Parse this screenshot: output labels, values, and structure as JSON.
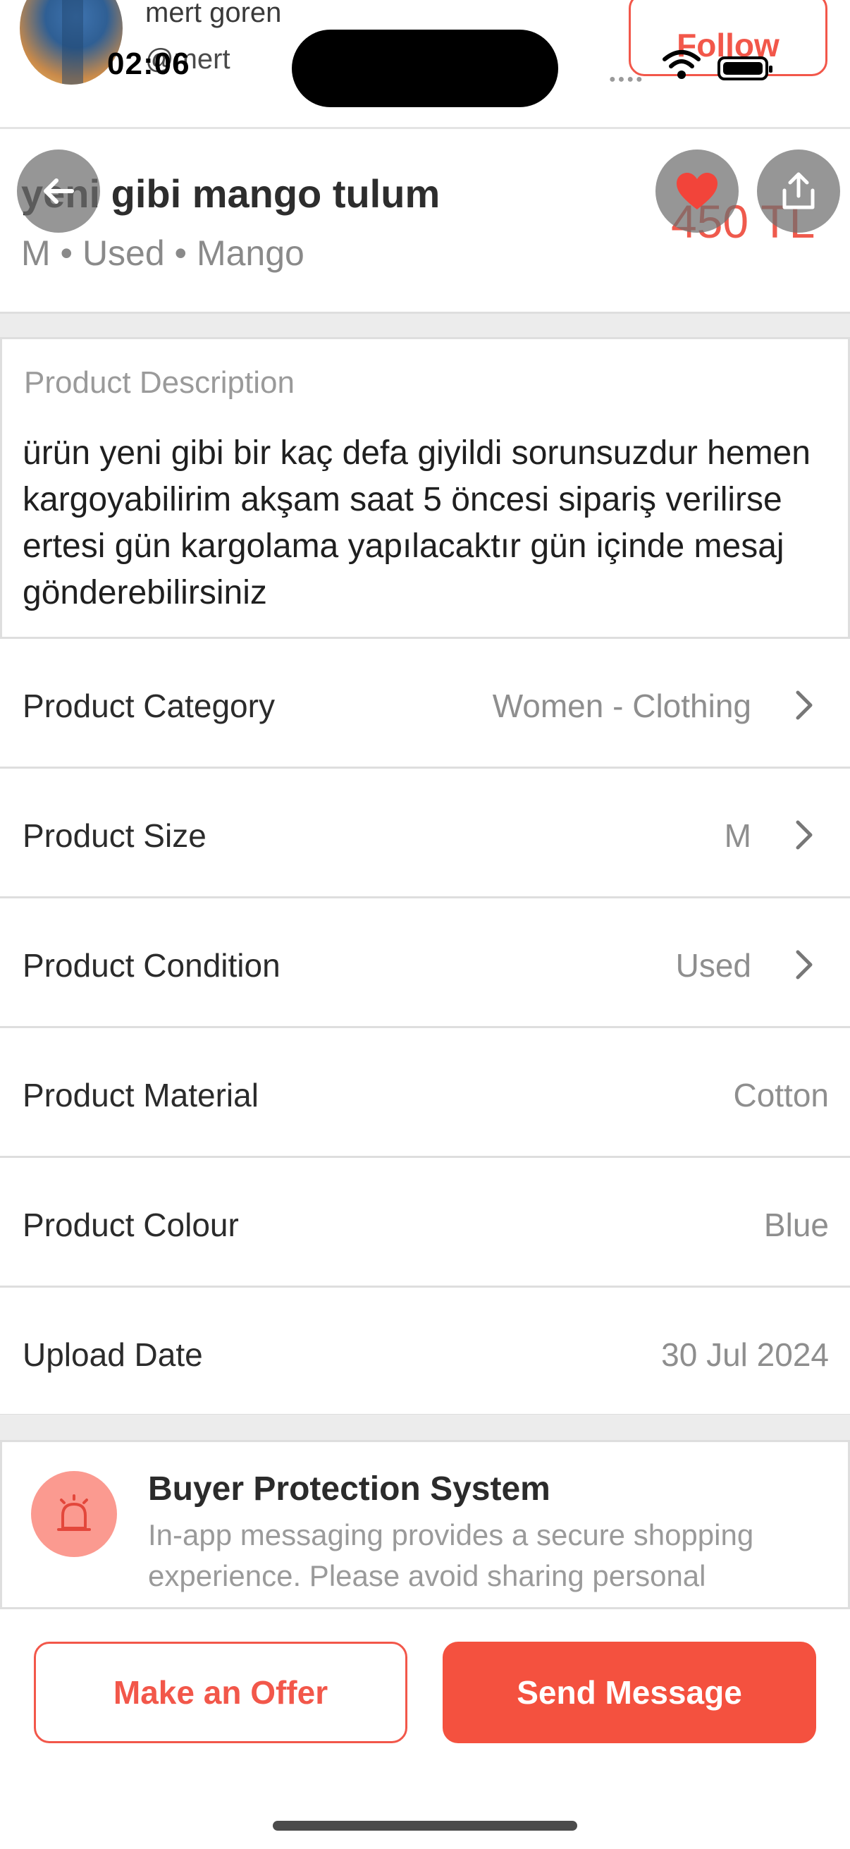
{
  "status": {
    "time": "02:06"
  },
  "seller": {
    "name": "mert goren",
    "handle": "@mert",
    "follow_label": "Follow"
  },
  "product": {
    "title": "yeni gibi mango tulum",
    "subtitle": "M • Used • Mango",
    "price": "450 TL"
  },
  "icons": {
    "back": "arrow-left-icon",
    "favorite": "heart-icon",
    "share": "share-icon",
    "protection": "alarm-icon",
    "chevron": "chevron-right-icon"
  },
  "description": {
    "label": "Product Description",
    "text": "ürün yeni gibi bir kaç defa giyildi sorunsuzdur hemen kargoyabilirim akşam saat 5 öncesi sipariş verilirse ertesi gün kargolama yapılacaktır gün içinde mesaj gönderebilirsiniz"
  },
  "attributes": [
    {
      "label": "Product Category",
      "value": "Women - Clothing",
      "has_chevron": true
    },
    {
      "label": "Product Size",
      "value": "M",
      "has_chevron": true
    },
    {
      "label": "Product Condition",
      "value": "Used",
      "has_chevron": true
    },
    {
      "label": "Product Material",
      "value": "Cotton",
      "has_chevron": false
    },
    {
      "label": "Product Colour",
      "value": "Blue",
      "has_chevron": false
    },
    {
      "label": "Upload Date",
      "value": "30 Jul 2024",
      "has_chevron": false
    }
  ],
  "buyer_protection": {
    "title": "Buyer Protection System",
    "text": "In-app messaging provides a secure shopping experience. Please avoid sharing personal"
  },
  "actions": {
    "offer_label": "Make an Offer",
    "message_label": "Send Message"
  },
  "colors": {
    "accent": "#F4513F",
    "price": "#EF5A4D",
    "muted": "#8E8E8E"
  }
}
